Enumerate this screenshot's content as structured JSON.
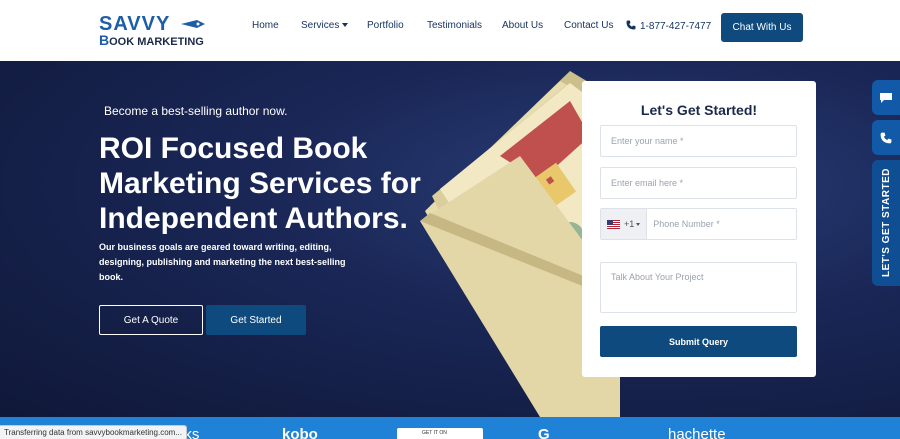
{
  "brand": {
    "logo_top": "SAVVY",
    "logo_bottom_initial": "B",
    "logo_bottom_rest": "OOK MARKETING"
  },
  "nav": {
    "items": [
      {
        "label": "Home"
      },
      {
        "label": "Services"
      },
      {
        "label": "Portfolio"
      },
      {
        "label": "Testimonials"
      },
      {
        "label": "About Us"
      },
      {
        "label": "Contact Us"
      }
    ],
    "phone": "1-877-427-7477",
    "chat_label": "Chat With Us"
  },
  "hero": {
    "tagline": "Become a best-selling author now.",
    "title": "ROI Focused Book Marketing Services for Independent Authors.",
    "description": "Our business goals are geared toward writing, editing, designing, publishing and marketing the next best-selling book.",
    "quote_label": "Get A Quote",
    "start_label": "Get Started"
  },
  "form": {
    "title": "Let's Get Started!",
    "name_placeholder": "Enter your name *",
    "email_placeholder": "Enter email here *",
    "country_code": "+1",
    "phone_placeholder": "Phone Number *",
    "message_placeholder": "Talk About Your Project",
    "submit_label": "Submit Query"
  },
  "side": {
    "start_label": "LET'S GET STARTED"
  },
  "strip": {
    "logo_1": "oks",
    "logo_2": "kobo",
    "playbox_text": "GET IT ON",
    "logo_4": "G",
    "logo_5": "hachette"
  },
  "status": {
    "text": "Transferring data from savvybookmarketing.com..."
  },
  "colors": {
    "primary": "#0e4a7d",
    "hero_bg": "#1a2757",
    "accent_blue": "#1f82d6"
  }
}
